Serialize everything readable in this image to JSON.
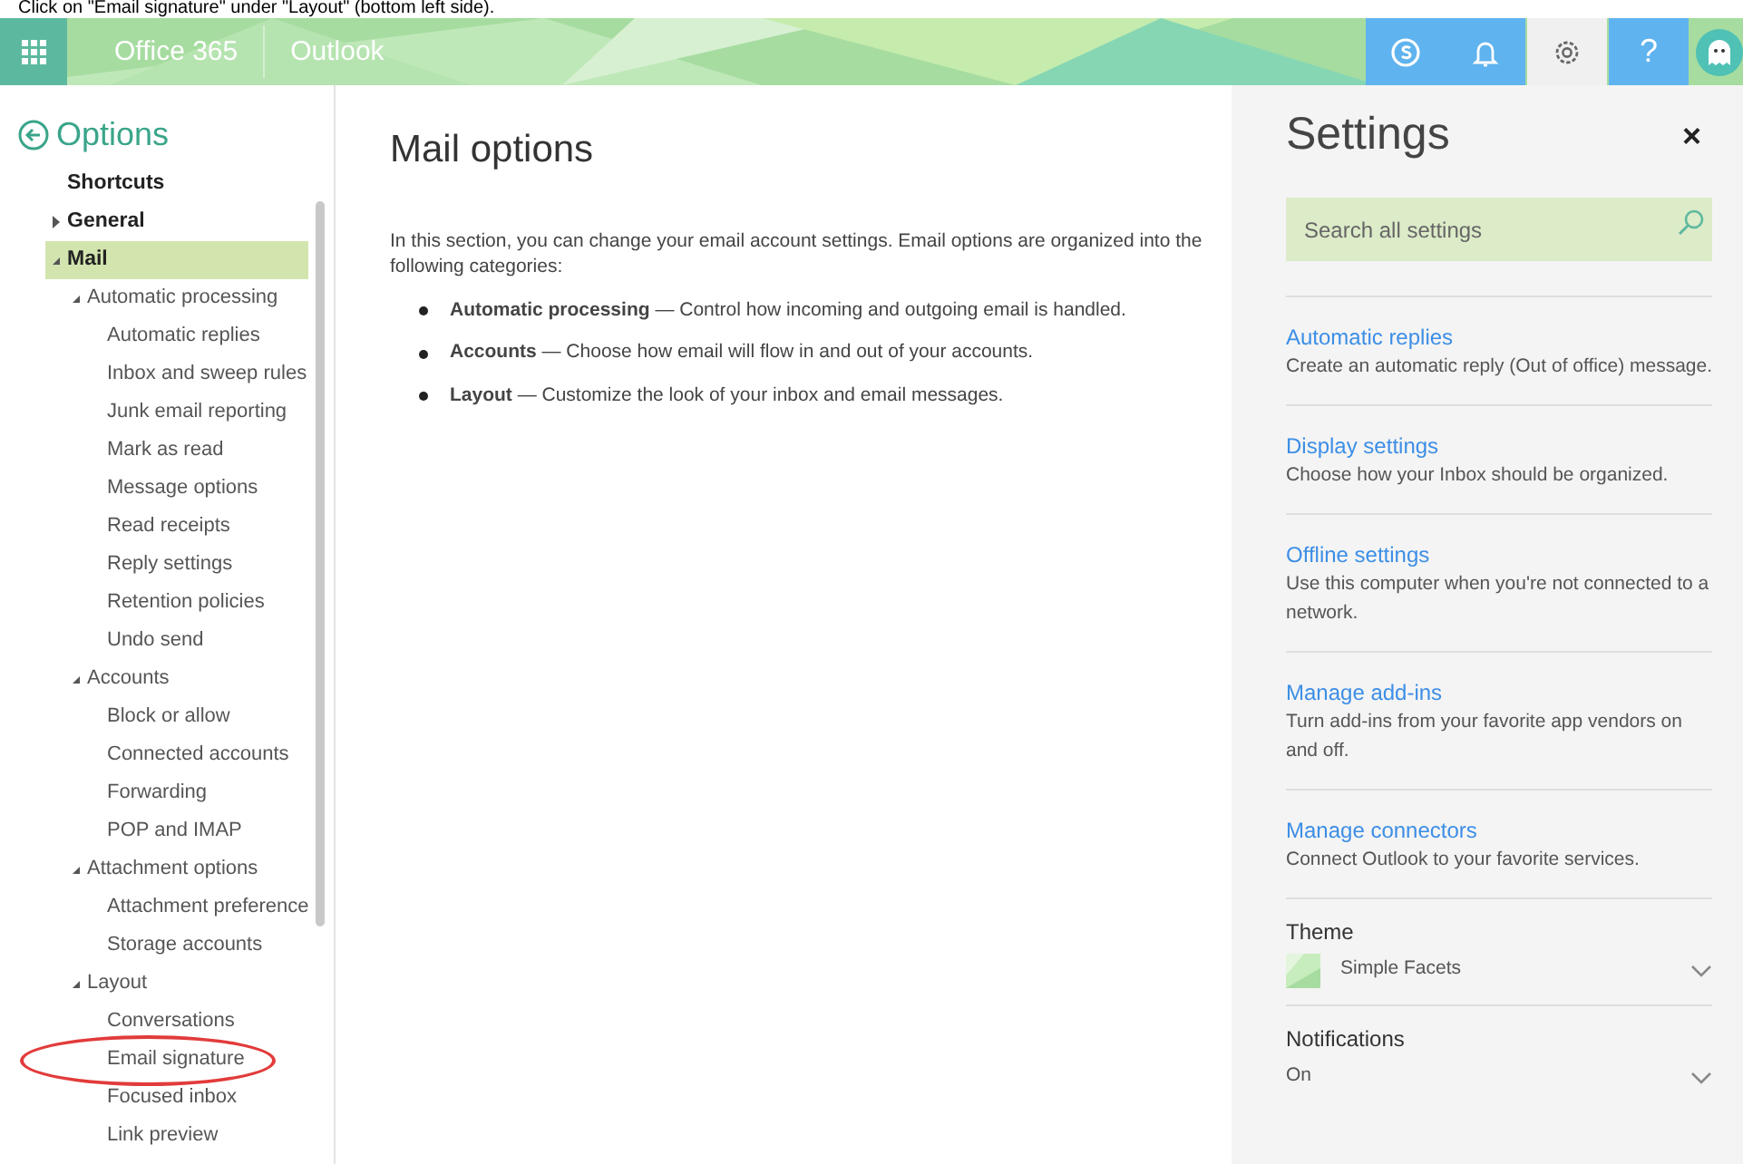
{
  "caption": "Click on \"Email signature\" under \"Layout\" (bottom left side).",
  "header": {
    "brand": "Office 365",
    "app": "Outlook",
    "buttons": [
      {
        "kind": "skype",
        "selected": false
      },
      {
        "kind": "bell",
        "selected": false
      },
      {
        "kind": "gear",
        "selected": true
      },
      {
        "kind": "help",
        "label": "?",
        "selected": false
      }
    ]
  },
  "sidebar": {
    "title": "Options",
    "items": [
      {
        "label": "Shortcuts",
        "selected": false,
        "circled": false
      },
      {
        "label": "General",
        "expanded": false,
        "selected": false,
        "circled": false
      },
      {
        "label": "Mail",
        "expanded": true,
        "selected": true,
        "circled": false,
        "children": [
          {
            "label": "Automatic processing",
            "expanded": true,
            "selected": false,
            "circled": false,
            "children": [
              {
                "label": "Automatic replies",
                "selected": false,
                "circled": false
              },
              {
                "label": "Inbox and sweep rules",
                "selected": false,
                "circled": false
              },
              {
                "label": "Junk email reporting",
                "selected": false,
                "circled": false
              },
              {
                "label": "Mark as read",
                "selected": false,
                "circled": false
              },
              {
                "label": "Message options",
                "selected": false,
                "circled": false
              },
              {
                "label": "Read receipts",
                "selected": false,
                "circled": false
              },
              {
                "label": "Reply settings",
                "selected": false,
                "circled": false
              },
              {
                "label": "Retention policies",
                "selected": false,
                "circled": false
              },
              {
                "label": "Undo send",
                "selected": false,
                "circled": false
              }
            ]
          },
          {
            "label": "Accounts",
            "expanded": true,
            "selected": false,
            "circled": false,
            "children": [
              {
                "label": "Block or allow",
                "selected": false,
                "circled": false
              },
              {
                "label": "Connected accounts",
                "selected": false,
                "circled": false
              },
              {
                "label": "Forwarding",
                "selected": false,
                "circled": false
              },
              {
                "label": "POP and IMAP",
                "selected": false,
                "circled": false
              }
            ]
          },
          {
            "label": "Attachment options",
            "expanded": true,
            "selected": false,
            "circled": false,
            "children": [
              {
                "label": "Attachment preference",
                "selected": false,
                "circled": false
              },
              {
                "label": "Storage accounts",
                "selected": false,
                "circled": false
              }
            ]
          },
          {
            "label": "Layout",
            "expanded": true,
            "selected": false,
            "circled": false,
            "children": [
              {
                "label": "Conversations",
                "selected": false,
                "circled": false
              },
              {
                "label": "Email signature",
                "selected": false,
                "circled": true
              },
              {
                "label": "Focused inbox",
                "selected": false,
                "circled": false
              },
              {
                "label": "Link preview",
                "selected": false,
                "circled": false
              }
            ]
          }
        ]
      }
    ]
  },
  "main": {
    "title": "Mail options",
    "intro": "In this section, you can change your email account settings. Email options are organized into the following categories:",
    "bullets": [
      "**Automatic processing** — Control how incoming and outgoing email is handled.",
      "**Accounts** — Choose how email will flow in and out of your accounts.",
      "**Layout** — Customize the look of your inbox and email messages."
    ]
  },
  "settings": {
    "title": "Settings",
    "close": "×",
    "search": {
      "placeholder": "Search all settings"
    },
    "sections": [
      {
        "kind": "link",
        "title": "Automatic replies",
        "description": "Create an automatic reply (Out of office) message."
      },
      {
        "kind": "link",
        "title": "Display settings",
        "description": "Choose how your Inbox should be organized."
      },
      {
        "kind": "link",
        "title": "Offline settings",
        "description": "Use this computer when you're not connected to a network."
      },
      {
        "kind": "link",
        "title": "Manage add-ins",
        "description": "Turn add-ins from your favorite app vendors on and off."
      },
      {
        "kind": "link",
        "title": "Manage connectors",
        "description": "Connect Outlook to your favorite services."
      },
      {
        "kind": "dropdown",
        "title": "Theme",
        "value": "Simple Facets",
        "thumbnail": true
      },
      {
        "kind": "dropdown",
        "title": "Notifications",
        "value": "On",
        "thumbnail": false
      }
    ]
  }
}
